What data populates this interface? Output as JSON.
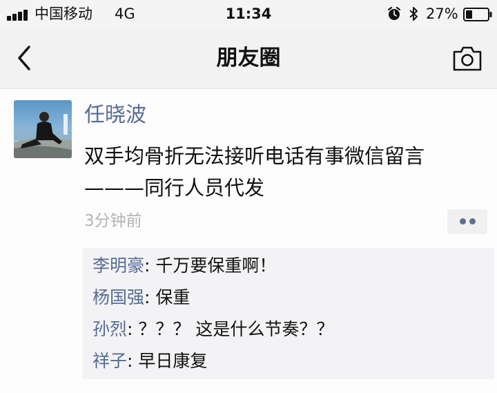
{
  "status_bar": {
    "carrier": "中国移动",
    "network": "4G",
    "time": "11:34",
    "battery": "27%",
    "icons": [
      "signal-icon",
      "alarm-icon",
      "bluetooth-icon",
      "battery-icon"
    ]
  },
  "nav": {
    "title": "朋友圈",
    "back_icon": "chevron-left-icon",
    "camera_icon": "camera-icon"
  },
  "post": {
    "author": "任晓波",
    "text_lines": [
      "双手均骨折无法接听电话有事微信留言",
      "———同行人员代发"
    ],
    "time_ago": "3分钟前",
    "more_icon": "more-dots-icon"
  },
  "comments": [
    {
      "author": "李明豪",
      "separator": ": ",
      "text": "千万要保重啊！"
    },
    {
      "author": "杨国强",
      "separator": ": ",
      "text": "保重"
    },
    {
      "author": "孙烈",
      "separator": ": ",
      "text": "？？？ 这是什么节奏？？"
    },
    {
      "author": "祥子",
      "separator": ": ",
      "text": "早日康复"
    }
  ],
  "colors": {
    "link": "#576b95",
    "text": "#111111",
    "muted": "#b2b2b2",
    "nav_bg": "#f2f2f2",
    "comment_bg": "#f3f3f5"
  }
}
